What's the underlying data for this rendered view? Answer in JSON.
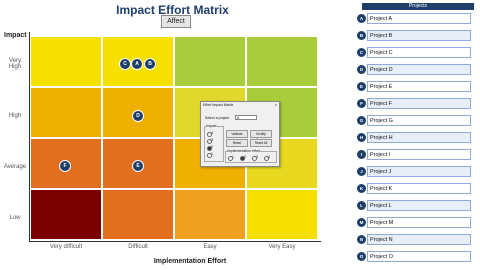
{
  "title": "Impact Effort Matrix",
  "affect_button": "Affect",
  "y_axis_title": "Impact",
  "x_axis_title": "Implementation Effort",
  "y_labels": [
    "Very High",
    "High",
    "Average",
    "Low"
  ],
  "x_labels": [
    "Very difficult",
    "Difficult",
    "Easy",
    "Very Easy"
  ],
  "colors": {
    "row0": [
      "#f5e000",
      "#f5e000",
      "#a8cc3c",
      "#a8cc3c"
    ],
    "row1": [
      "#f0b000",
      "#f0b000",
      "#e0d82a",
      "#a8cc3c"
    ],
    "row2": [
      "#e07020",
      "#e07020",
      "#f0b000",
      "#e8d820"
    ],
    "row3": [
      "#7d0000",
      "#e07020",
      "#f0a020",
      "#f5e000"
    ],
    "navy": "#1f3f6b"
  },
  "bubbles": [
    {
      "label": "C"
    },
    {
      "label": "A"
    },
    {
      "label": "B"
    },
    {
      "label": "D"
    },
    {
      "label": "F"
    },
    {
      "label": "E"
    }
  ],
  "dialog": {
    "title": "Effort Impact Matrix",
    "close": "×",
    "select_label": "Select a project",
    "select_value": "A",
    "impact_label": "Impact",
    "effort_label": "Implementation effort",
    "buttons": [
      "Validate",
      "Modify Project",
      "Reset",
      "Reset All"
    ],
    "radio_impact": [
      "4",
      "3",
      "2",
      "1"
    ],
    "radio_effort": [
      "1",
      "2",
      "3",
      "4"
    ]
  },
  "projects_header": "Projects",
  "projects": [
    {
      "badge": "A",
      "name": "Project A"
    },
    {
      "badge": "B",
      "name": "Project B"
    },
    {
      "badge": "C",
      "name": "Project C"
    },
    {
      "badge": "D",
      "name": "Project D"
    },
    {
      "badge": "E",
      "name": "Project E"
    },
    {
      "badge": "F",
      "name": "Project F"
    },
    {
      "badge": "G",
      "name": "Project G"
    },
    {
      "badge": "H",
      "name": "Project H"
    },
    {
      "badge": "I",
      "name": "Project I"
    },
    {
      "badge": "J",
      "name": "Project J"
    },
    {
      "badge": "K",
      "name": "Project K"
    },
    {
      "badge": "L",
      "name": "Project L"
    },
    {
      "badge": "M",
      "name": "Project M"
    },
    {
      "badge": "N",
      "name": "Project N"
    },
    {
      "badge": "O",
      "name": "Project O"
    }
  ]
}
